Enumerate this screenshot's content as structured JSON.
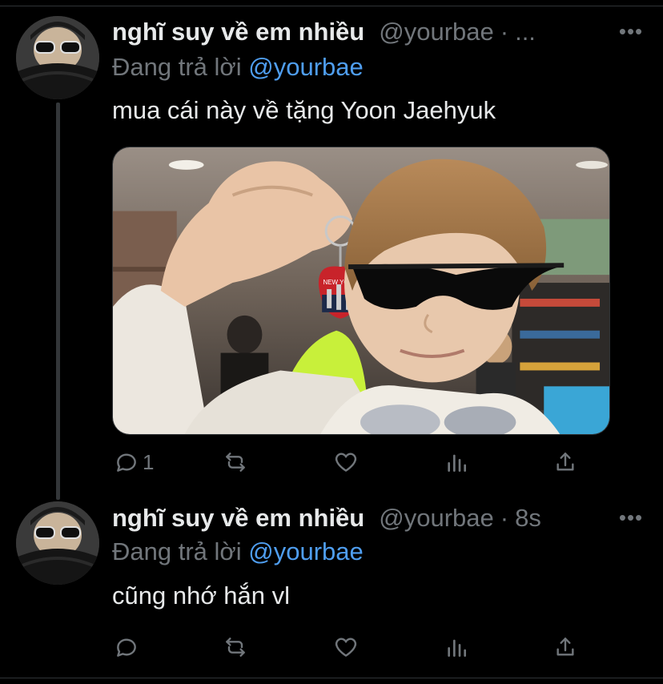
{
  "tweets": [
    {
      "author": {
        "display_name": "nghĩ suy về em nhiều",
        "handle": "@yourbae"
      },
      "separator": "·",
      "time": "...",
      "reply_prefix": "Đang trả lời",
      "reply_to": "@yourbae",
      "text": "mua cái này về tặng Yoon Jaehyuk",
      "media": {
        "keychain_text": "NEW YORK"
      },
      "actions": {
        "reply_count": "1"
      }
    },
    {
      "author": {
        "display_name": "nghĩ suy về em nhiều",
        "handle": "@yourbae"
      },
      "separator": "·",
      "time": "8s",
      "reply_prefix": "Đang trả lời",
      "reply_to": "@yourbae",
      "text": "cũng nhớ hắn vl",
      "actions": {
        "reply_count": ""
      }
    }
  ],
  "icons": {
    "reply": "reply-icon",
    "retweet": "retweet-icon",
    "like": "like-icon",
    "views": "views-icon",
    "share": "share-icon",
    "more": "more-icon"
  },
  "colors": {
    "background": "#000000",
    "text": "#e7e9ea",
    "muted": "#71767b",
    "mention": "#4f9ef0",
    "thread_line": "#333639"
  }
}
